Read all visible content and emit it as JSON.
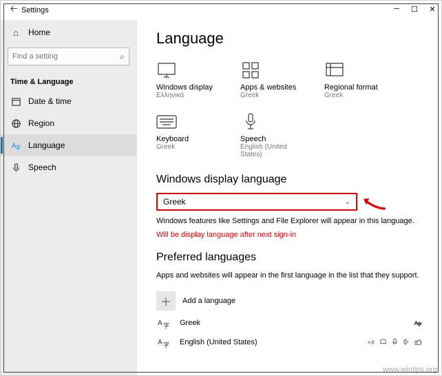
{
  "titlebar": {
    "title": "Settings"
  },
  "sidebar": {
    "home": "Home",
    "search_placeholder": "Find a setting",
    "category": "Time & Language",
    "items": [
      {
        "label": "Date & time"
      },
      {
        "label": "Region"
      },
      {
        "label": "Language"
      },
      {
        "label": "Speech"
      }
    ]
  },
  "main": {
    "title": "Language",
    "tiles": [
      {
        "name": "Windows display",
        "value": "Ελληνικά"
      },
      {
        "name": "Apps & websites",
        "value": "Greek"
      },
      {
        "name": "Regional format",
        "value": "Greek"
      },
      {
        "name": "Keyboard",
        "value": "Greek"
      },
      {
        "name": "Speech",
        "value": "English (United States)"
      }
    ],
    "section_display": "Windows display language",
    "dropdown_value": "Greek",
    "display_desc": "Windows features like Settings and File Explorer will appear in this language.",
    "display_warn": "Will be display language after next sign-in",
    "section_pref": "Preferred languages",
    "pref_desc": "Apps and websites will appear in the first language in the list that they support.",
    "add_label": "Add a language",
    "langs": [
      {
        "label": "Greek",
        "icons": 1
      },
      {
        "label": "English (United States)",
        "icons": 5
      }
    ]
  },
  "watermark": "www.wintips.org"
}
